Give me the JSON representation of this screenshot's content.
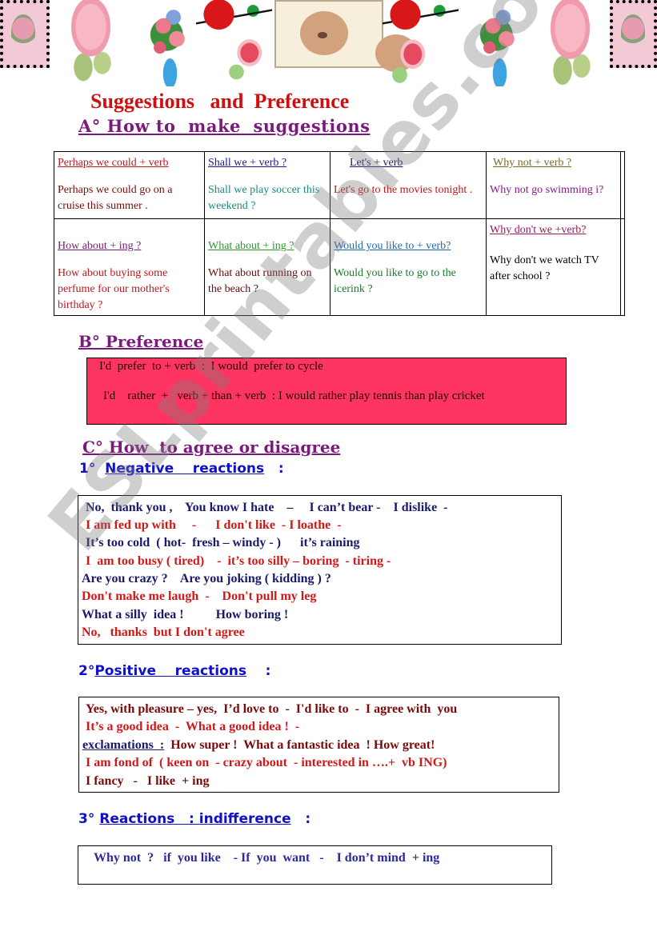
{
  "banner": {
    "images": [
      "stamp-rose",
      "pink-rose-with-bee",
      "flower-bouquet",
      "red-rose",
      "rose-bud",
      "teddy-bear",
      "red-rose",
      "rose-bud",
      "flower-bouquet",
      "pink-rose-with-bee",
      "stamp-rose"
    ]
  },
  "title": "Suggestions   and  Preference",
  "section_a": {
    "heading": "A° How to  make  suggestions",
    "table": [
      [
        {
          "pattern": "Perhaps we could + verb",
          "example": "Perhaps we could   go on a cruise this summer .",
          "pattern_color": "#c0161c",
          "example_color": "#7a0a0a"
        },
        {
          "pattern": "Shall we + verb ?",
          "example": "Shall we play soccer this weekend ?",
          "pattern_color": "#1a1a8a",
          "example_color": "#1a8a7a"
        },
        {
          "pattern": "Let's + verb",
          "example": "Let's  go to the movies tonight  .",
          "pattern_color": "#1a1a6a",
          "example_color": "#c0161c"
        },
        {
          "pattern": "Why not + verb ?",
          "example": "Why not go swimming i?",
          "pattern_color": "#7a6a2a",
          "example_color": "#8a1a8a"
        }
      ],
      [
        {
          "pattern": "How  about + ing ?",
          "example": "How about buying some perfume for our mother's birthday ?",
          "pattern_color": "#7a1a7a",
          "example_color": "#c0161c"
        },
        {
          "pattern": "What about + ing ?",
          "example": "What about running on the beach ?",
          "pattern_color": "#2a9a2a",
          "example_color": "#6a0a0a"
        },
        {
          "pattern": "Would you like to + verb?",
          "example": "Would you like to go to the icerink ?",
          "pattern_color": "#1a6ab0",
          "example_color": "#1a7a2a"
        },
        {
          "pattern": "Why don't we +verb?",
          "example": "Why don't we watch TV after school ?",
          "pattern_color": "#9a1a5a",
          "example_color": "#000000"
        }
      ]
    ]
  },
  "section_b": {
    "heading": "B° Preference",
    "box_color": "#fe3560",
    "lines": [
      "I'd  prefer  to + verb  :  I would  prefer to cycle",
      "I'd    rather  +   verb + than + verb  : I would rather play tennis than play cricket"
    ]
  },
  "section_c": {
    "heading": "C° How  to agree or disagree",
    "negative": {
      "number": "1°  ",
      "label": "Negative    reactions",
      "colon": "   :",
      "lines": [
        {
          "text": "No,  thank you ,    You know I hate    –     I can’t bear -    I dislike  -",
          "color": "navy"
        },
        {
          "text": "I am fed up with     -      I don't like  - I loathe  -",
          "color": "red"
        },
        {
          "text": "It’s too cold  ( hot-  fresh – windy - )      it’s raining",
          "color": "navy"
        },
        {
          "text": "I  am too busy ( tired)    -  it’s too silly – boring  - tiring -",
          "color": "red"
        },
        {
          "text": "Are you crazy ?    Are you joking ( kidding ) ?",
          "color": "navy"
        },
        {
          "text": "Don't make me laugh  -    Don't pull my leg",
          "color": "red"
        },
        {
          "text": "What a silly  idea !          How boring !",
          "color": "navy"
        },
        {
          "text": "No,   thanks  but I don't agree",
          "color": "red"
        }
      ]
    },
    "positive": {
      "number": "2°",
      "label": "Positive    reactions",
      "colon": "    :",
      "lines": [
        {
          "text": "Yes, with pleasure – yes,  I’d love to  -  I'd like to  -  I agree with  you",
          "color": "maroon"
        },
        {
          "text": "It’s a good idea  -  What a good idea !  -",
          "color": "red"
        },
        {
          "label": "exclamations  :",
          "text": "  How super !  What a fantastic idea  ! How great!",
          "color": "maroon"
        },
        {
          "text": "I am fond of  ( keen on  - crazy about  - interested in ….+  vb ING)",
          "color": "red"
        },
        {
          "text": "I fancy   -   I like  + ing",
          "color": "maroon"
        }
      ]
    },
    "indifference": {
      "number": "3°",
      "label": "Reactions   : indifference",
      "colon": "   :",
      "lines": [
        {
          "text": "Why not  ?   if  you like    - If  you  want   -    I don’t mind  + ing",
          "color": "indigo"
        }
      ]
    }
  },
  "watermark": "ESLprintables.com"
}
